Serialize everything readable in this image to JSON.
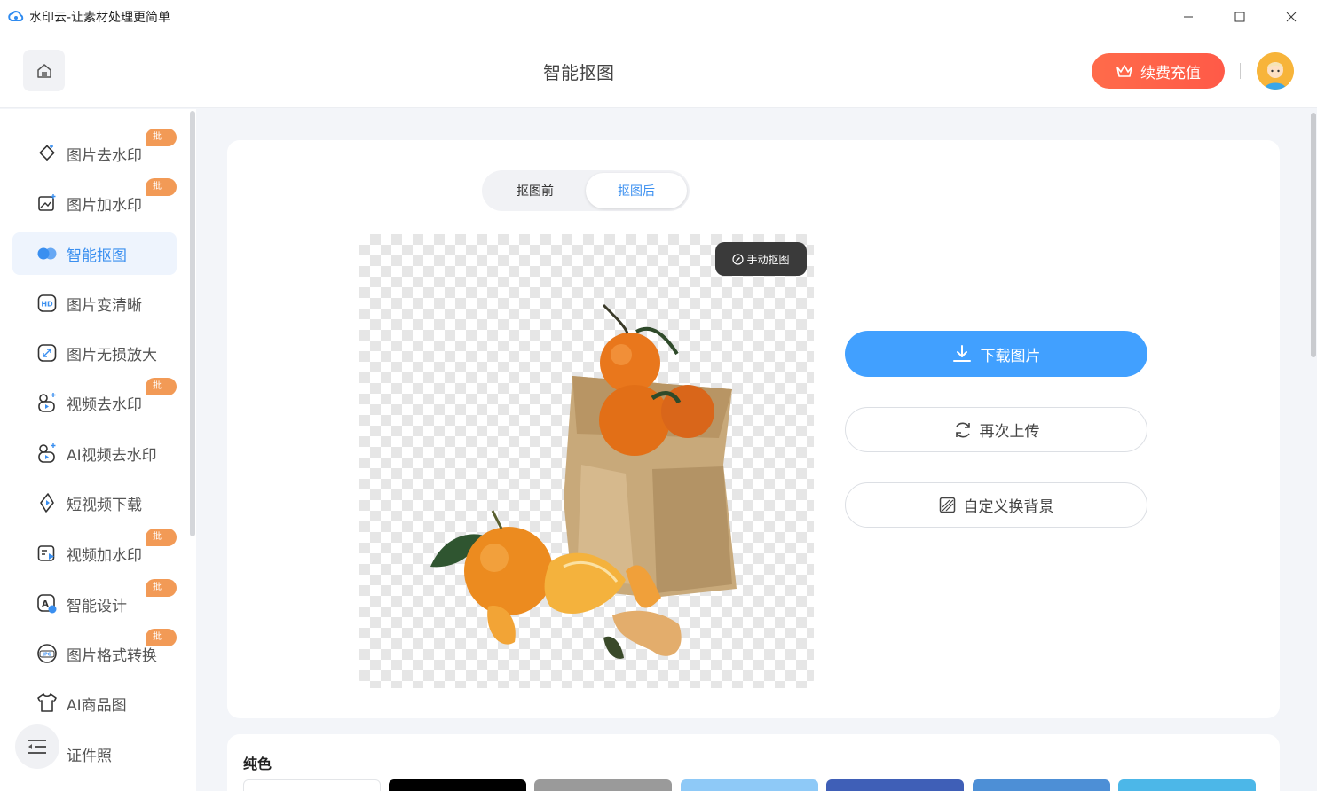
{
  "window": {
    "title": "水印云-让素材处理更简单"
  },
  "header": {
    "title": "智能抠图",
    "renew_label": "续费充值"
  },
  "sidebar": {
    "items": [
      {
        "label": "图片去水印",
        "badge": "批量",
        "icon": "eraser-icon"
      },
      {
        "label": "图片加水印",
        "badge": "批量",
        "icon": "image-add-icon"
      },
      {
        "label": "智能抠图",
        "badge": "",
        "icon": "cutout-icon"
      },
      {
        "label": "图片变清晰",
        "badge": "",
        "icon": "hd-icon"
      },
      {
        "label": "图片无损放大",
        "badge": "",
        "icon": "expand-icon"
      },
      {
        "label": "视频去水印",
        "badge": "批量",
        "icon": "video-remove-icon"
      },
      {
        "label": "AI视频去水印",
        "badge": "",
        "icon": "ai-video-icon"
      },
      {
        "label": "短视频下载",
        "badge": "",
        "icon": "download-video-icon"
      },
      {
        "label": "视频加水印",
        "badge": "批量",
        "icon": "video-add-icon"
      },
      {
        "label": "智能设计",
        "badge": "批量",
        "icon": "design-icon"
      },
      {
        "label": "图片格式转换",
        "badge": "批量",
        "icon": "jpg-icon"
      },
      {
        "label": "AI商品图",
        "badge": "",
        "icon": "shirt-icon"
      },
      {
        "label": "证件照",
        "badge": "",
        "icon": "id-photo-icon"
      }
    ]
  },
  "toggle": {
    "before": "抠图前",
    "after": "抠图后"
  },
  "preview": {
    "manual_label": "手动抠图"
  },
  "actions": {
    "download": "下载图片",
    "reupload": "再次上传",
    "custom_bg": "自定义换背景"
  },
  "bottom": {
    "title": "纯色",
    "swatches": [
      "#ffffff",
      "#000000",
      "#9a9a9a",
      "#8ec9f7",
      "#3f5fb7",
      "#4d8fd6",
      "#4cb7e8"
    ]
  },
  "colors": {
    "accent": "#41a0ff",
    "renew": "#ff5f48",
    "badge": "#f29a56"
  }
}
